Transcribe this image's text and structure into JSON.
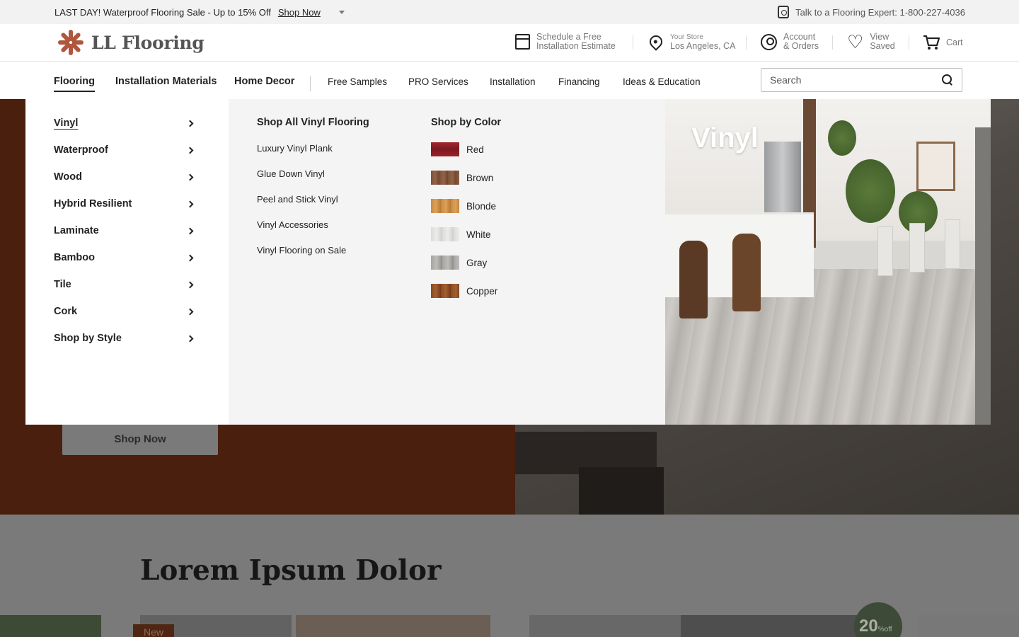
{
  "promo": {
    "message": "LAST DAY! Waterproof Flooring Sale - Up to 15% Off",
    "link": "Shop Now",
    "expert": "Talk to a Flooring Expert: 1-800-227-4036"
  },
  "header": {
    "logo": "LL Flooring",
    "schedule_line1": "Schedule a Free",
    "schedule_line2": "Installation Estimate",
    "store_label": "Your Store",
    "store_value": "Los Angeles, CA",
    "account_line1": "Account",
    "account_line2": "& Orders",
    "saved_line1": "View",
    "saved_line2": "Saved",
    "cart": "Cart"
  },
  "nav": {
    "main": [
      "Flooring",
      "Installation Materials",
      "Home Decor"
    ],
    "secondary": [
      "Free Samples",
      "PRO Services",
      "Installation",
      "Financing",
      "Ideas & Education"
    ],
    "search_placeholder": "Search"
  },
  "mega": {
    "categories": [
      "Vinyl",
      "Waterproof",
      "Wood",
      "Hybrid Resilient",
      "Laminate",
      "Bamboo",
      "Tile",
      "Cork",
      "Shop by Style"
    ],
    "shop_all": "Shop All Vinyl Flooring",
    "links": [
      "Luxury Vinyl Plank",
      "Glue Down Vinyl",
      "Peel and Stick Vinyl",
      "Vinyl Accessories",
      "Vinyl Flooring on Sale"
    ],
    "color_title": "Shop by Color",
    "colors": [
      {
        "name": "Red",
        "hex": "#8e1e26"
      },
      {
        "name": "Brown",
        "hex": "#7a5238"
      },
      {
        "name": "Blonde",
        "hex": "#c98a3e"
      },
      {
        "name": "White",
        "hex": "#dcdcda"
      },
      {
        "name": "Gray",
        "hex": "#a6a5a2"
      },
      {
        "name": "Copper",
        "hex": "#8a4a22"
      }
    ],
    "image_title": "Vinyl"
  },
  "hero": {
    "button": "Shop Now"
  },
  "lower": {
    "heading": "Lorem Ipsum Dolor",
    "new_tag": "New",
    "badge_number": "20",
    "badge_unit": "%",
    "badge_off": "off"
  },
  "colors": {
    "brand": "#b0563d",
    "hero_brown": "#4a1f0d"
  }
}
